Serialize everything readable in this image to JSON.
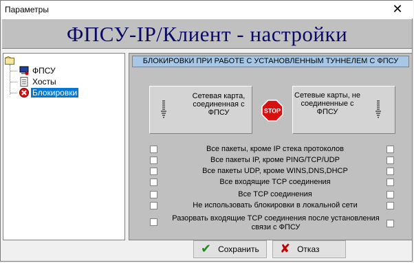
{
  "window": {
    "title": "Параметры",
    "close_glyph": "✕"
  },
  "header": {
    "title": "ФПСУ-IP/Клиент - настройки"
  },
  "tree": {
    "items": [
      {
        "label": "ФПСУ",
        "icon": "computer-icon"
      },
      {
        "label": "Хосты",
        "icon": "document-icon"
      },
      {
        "label": "Блокировки",
        "icon": "blocked-icon",
        "selected": true
      }
    ]
  },
  "panel": {
    "band_title": "БЛОКИРОВКИ ПРИ РАБОТЕ С УСТАНОВЛЕННЫМ ТУННЕЛЕМ С ФПСУ",
    "left_card": "Сетевая карта, соединенная с ФПСУ",
    "right_card": "Сетевые карты, не соединенные с ФПСУ",
    "stop_label": "STOP",
    "options": [
      {
        "label": "Все пакеты, кроме IP стека протоколов",
        "left_checked": false,
        "right_checked": false
      },
      {
        "label": "Все пакеты IP, кроме PING/TCP/UDP",
        "left_checked": false,
        "right_checked": false
      },
      {
        "label": "Все пакеты UDP, кроме WINS,DNS,DHCP",
        "left_checked": false,
        "right_checked": false
      },
      {
        "label": "Все входящие TCP соединения",
        "left_checked": false,
        "right_checked": false
      },
      {
        "label": "Все TCP соединения",
        "left_checked": false,
        "right_checked": false
      },
      {
        "label": "Не использовать блокировки в локальной сети",
        "left_checked": false,
        "right_checked": false
      },
      {
        "label": "Разорвать входящие TCP соединения после установления связи с ФПСУ",
        "left_checked": false,
        "right_checked": false
      }
    ]
  },
  "buttons": {
    "save": {
      "label": "Сохранить",
      "icon": "checkmark-icon",
      "color": "#1a8f1a"
    },
    "cancel": {
      "label": "Отказ",
      "icon": "cross-icon",
      "color": "#c00000"
    }
  }
}
